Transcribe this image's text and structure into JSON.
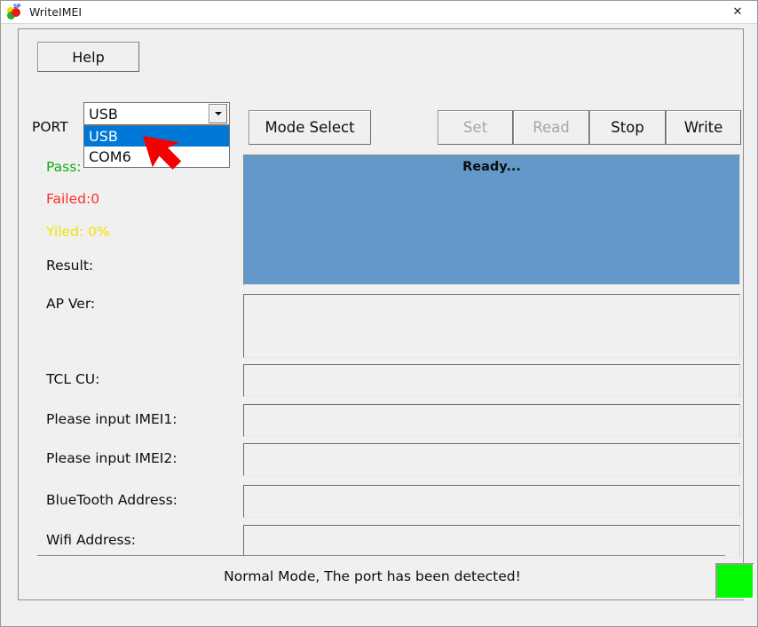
{
  "window": {
    "title": "WriteIMEI",
    "icon": "app-logo-icon",
    "close_label": "✕"
  },
  "toolbar": {
    "help_label": "Help"
  },
  "port": {
    "label": "PORT",
    "selected": "USB",
    "dropdown_open": true,
    "options": [
      {
        "label": "USB",
        "selected": true
      },
      {
        "label": "COM6",
        "selected": false
      }
    ]
  },
  "actions": {
    "mode_select_label": "Mode Select",
    "set_label": "Set",
    "set_enabled": false,
    "read_label": "Read",
    "read_enabled": false,
    "stop_label": "Stop",
    "stop_enabled": true,
    "write_label": "Write",
    "write_enabled": true
  },
  "counters": {
    "pass_label": "Pass:",
    "pass_color": "#1aaa1a",
    "failed_label": "Failed:0",
    "failed_color": "#ff2d2d",
    "yiled_label": "Yiled: 0%",
    "yiled_color": "#f2e300",
    "result_label": "Result:"
  },
  "console": {
    "message": "Ready...",
    "background_color": "#6398c9"
  },
  "fields": [
    {
      "label": "AP Ver:",
      "value": ""
    },
    {
      "label": "TCL CU:",
      "value": ""
    },
    {
      "label": "Please input IMEI1:",
      "value": ""
    },
    {
      "label": "Please input IMEI2:",
      "value": ""
    },
    {
      "label": "BlueTooth Address:",
      "value": ""
    },
    {
      "label": "Wifi Address:",
      "value": ""
    }
  ],
  "status": {
    "message": "Normal Mode, The port has been detected!",
    "indicator_color": "#00fa00"
  },
  "annotation": {
    "pointer": "red-arrow-cursor"
  }
}
